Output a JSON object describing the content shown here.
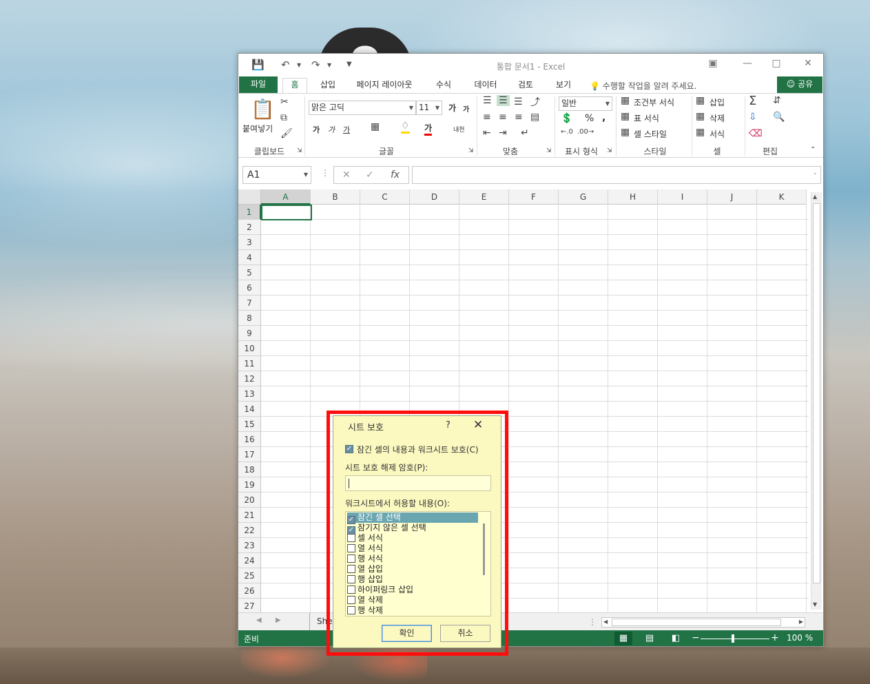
{
  "window": {
    "title": "통합 문서1 - Excel"
  },
  "tabs": {
    "file": "파일",
    "home": "홈",
    "insert": "삽입",
    "page_layout": "페이지 레이아웃",
    "formulas": "수식",
    "data": "데이터",
    "review": "검토",
    "view": "보기",
    "tell_me": "수행할 작업을 알려 주세요.",
    "share": "공유"
  },
  "ribbon": {
    "paste": "붙여넣기",
    "font_name": "맑은 고딕",
    "font_size": "11",
    "number_format": "일반",
    "bold": "가",
    "italic": "가",
    "underline": "가",
    "font_color_glyph": "가",
    "grow_font": "가",
    "shrink_font": "가",
    "phonetic": "내천",
    "conditional_format": "조건부 서식",
    "table_format": "표 서식",
    "cell_style": "셀 스타일",
    "insert_cells": "삽입",
    "delete_cells": "삭제",
    "format_cells": "서식",
    "percent": "%",
    "comma": ",",
    "groups": {
      "clipboard": "클립보드",
      "font": "글꼴",
      "alignment": "맞춤",
      "number": "표시 형식",
      "styles": "스타일",
      "cells": "셀",
      "editing": "편집"
    }
  },
  "formula_bar": {
    "name_box": "A1",
    "fx": "fx",
    "cancel": "✕",
    "enter": "✓"
  },
  "grid": {
    "columns": [
      "A",
      "B",
      "C",
      "D",
      "E",
      "F",
      "G",
      "H",
      "I",
      "J",
      "K"
    ],
    "rows": [
      "1",
      "2",
      "3",
      "4",
      "5",
      "6",
      "7",
      "8",
      "9",
      "10",
      "11",
      "12",
      "13",
      "14",
      "15",
      "16",
      "17",
      "18",
      "19",
      "20",
      "21",
      "22",
      "23",
      "24",
      "25",
      "26",
      "27"
    ],
    "active_cell": "A1"
  },
  "sheet_tab": "Sheet1",
  "status": {
    "ready": "준비",
    "zoom": "100 %"
  },
  "dialog": {
    "title": "시트 보호",
    "help": "?",
    "protect_label": "잠긴 셀의 내용과 워크시트 보호(C)",
    "protect_checked": true,
    "password_label": "시트 보호 해제 암호(P):",
    "password_value": "",
    "allow_label": "워크시트에서 허용할 내용(O):",
    "items": [
      {
        "label": "잠긴 셀 선택",
        "checked": true
      },
      {
        "label": "잠기지 않은 셀 선택",
        "checked": true
      },
      {
        "label": "셀 서식",
        "checked": false
      },
      {
        "label": "열 서식",
        "checked": false
      },
      {
        "label": "행 서식",
        "checked": false
      },
      {
        "label": "열 삽입",
        "checked": false
      },
      {
        "label": "행 삽입",
        "checked": false
      },
      {
        "label": "하이퍼링크 삽입",
        "checked": false
      },
      {
        "label": "열 삭제",
        "checked": false
      },
      {
        "label": "행 삭제",
        "checked": false
      }
    ],
    "ok": "확인",
    "cancel": "취소"
  },
  "colors": {
    "excel_green": "#217346",
    "dialog_bg": "#fbf9c0",
    "highlight_frame": "#ff0d0d"
  }
}
